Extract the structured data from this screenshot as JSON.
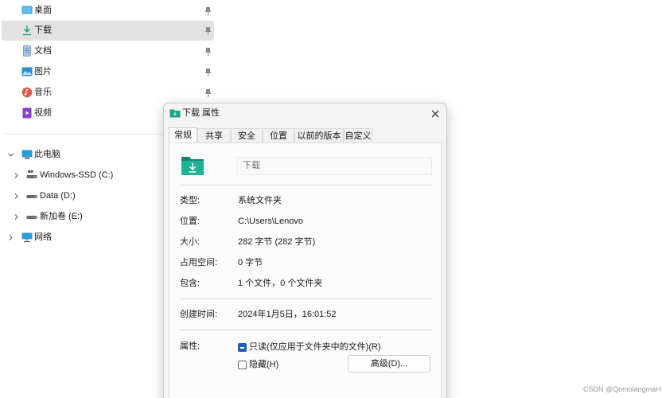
{
  "nav": {
    "quick_access": [
      {
        "label": "桌面",
        "icon": "desktop-icon"
      },
      {
        "label": "下载",
        "icon": "download-icon",
        "selected": true
      },
      {
        "label": "文档",
        "icon": "document-icon"
      },
      {
        "label": "图片",
        "icon": "pictures-icon"
      },
      {
        "label": "音乐",
        "icon": "music-icon"
      },
      {
        "label": "视频",
        "icon": "videos-icon"
      }
    ],
    "tree": [
      {
        "label": "此电脑",
        "icon": "computer-icon",
        "expanded": true
      },
      {
        "label": "Windows-SSD (C:)",
        "icon": "drive-icon"
      },
      {
        "label": "Data (D:)",
        "icon": "drive-icon"
      },
      {
        "label": "新加卷 (E:)",
        "icon": "drive-icon"
      },
      {
        "label": "网络",
        "icon": "network-icon"
      }
    ]
  },
  "dialog": {
    "title": "下载 属性",
    "tabs": [
      "常规",
      "共享",
      "安全",
      "位置",
      "以前的版本",
      "自定义"
    ],
    "active_tab": "常规",
    "folder_name": "下载",
    "properties": [
      {
        "label": "类型:",
        "value": "系统文件夹"
      },
      {
        "label": "位置:",
        "value": "C:\\Users\\Lenovo"
      },
      {
        "label": "大小:",
        "value": "282 字节 (282 字节)"
      },
      {
        "label": "占用空间:",
        "value": "0 字节"
      },
      {
        "label": "包含:",
        "value": "1 个文件，0 个文件夹"
      }
    ],
    "created": {
      "label": "创建时间:",
      "value": "2024年1月5日，16:01:52"
    },
    "attributes": {
      "label": "属性:",
      "readonly_label": "只读(仅应用于文件夹中的文件)(R)",
      "readonly_state": "indeterminate",
      "hidden_label": "隐藏(H)",
      "hidden_checked": false,
      "advanced_button": "高级(D)..."
    }
  },
  "watermark": "CSDN @QomolangmaH",
  "colors": {
    "accent": "#1f5fbf",
    "folder_teal": "#1aa28a",
    "selected_bg": "#e2e2e2"
  }
}
